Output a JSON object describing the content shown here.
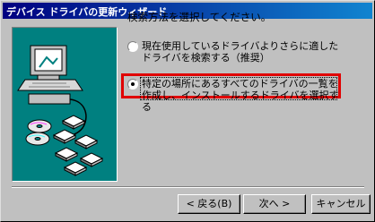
{
  "window": {
    "title": "デバイス ドライバの更新ウィザード"
  },
  "instruction": "検索方法を選択してください。",
  "options": [
    {
      "label": "現在使用しているドライバよりさらに適したドライバを検索する（推奨）",
      "selected": false
    },
    {
      "label": "特定の場所にあるすべてのドライバの一覧を作成し、インストールするドライバを選択する",
      "selected": true
    }
  ],
  "buttons": {
    "back": "< 戻る(B)",
    "next": "次へ >",
    "cancel": "キャンセル"
  },
  "colors": {
    "title_bar": "#000080",
    "highlight_box": "#e00000",
    "wizard_panel": "#008080"
  }
}
